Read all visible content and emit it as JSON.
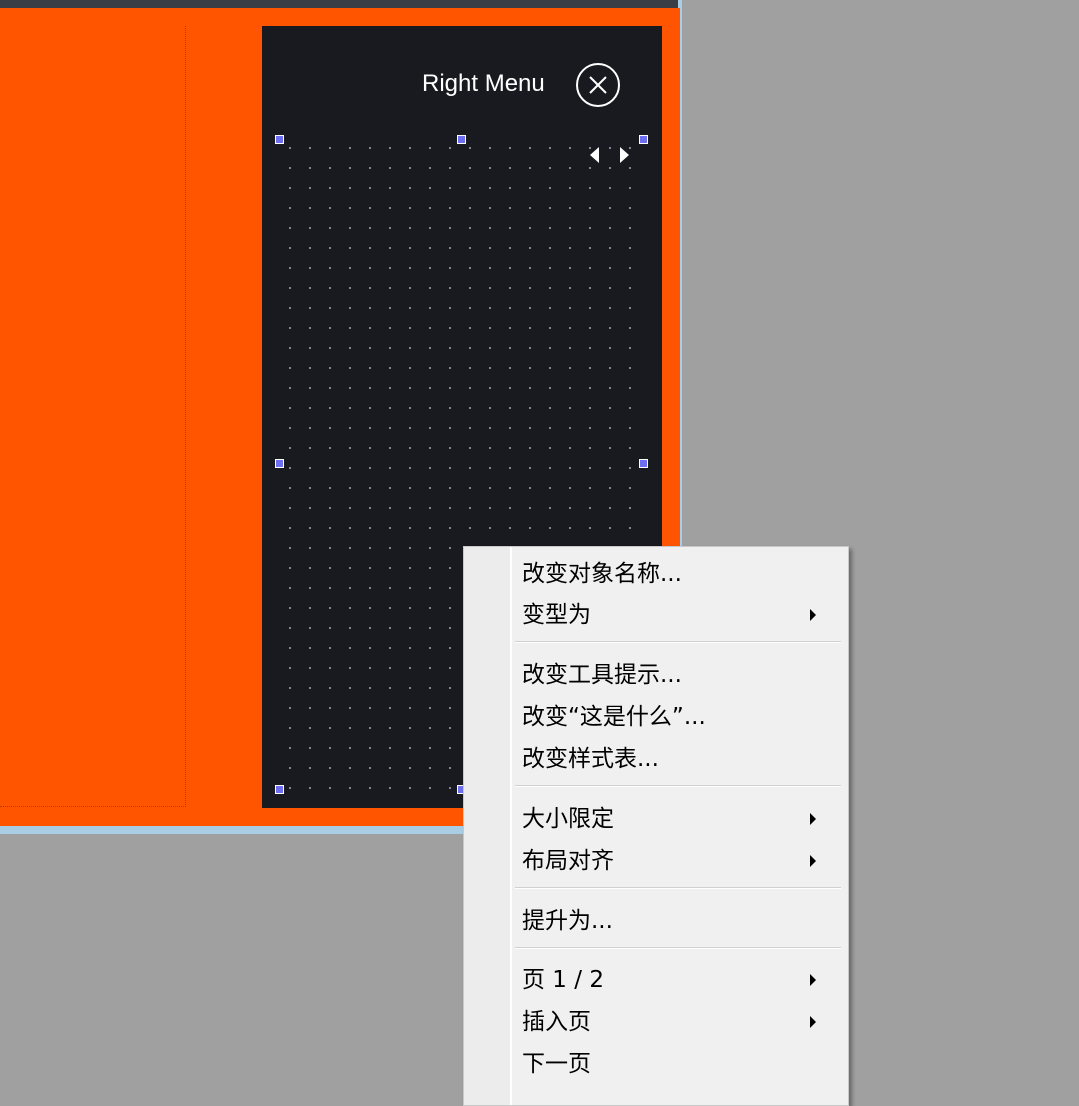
{
  "panel": {
    "title": "Right Menu",
    "close_icon": "close-circle-icon",
    "scroll_left_icon": "arrow-left-icon",
    "scroll_right_icon": "arrow-right-icon"
  },
  "context_menu": {
    "items": [
      {
        "label": "改变对象名称...",
        "submenu": false
      },
      {
        "label": "变型为",
        "submenu": true
      },
      {
        "label": "改变工具提示...",
        "submenu": false
      },
      {
        "label": "改变“这是什么”...",
        "submenu": false
      },
      {
        "label": "改变样式表...",
        "submenu": false
      },
      {
        "label": "大小限定",
        "submenu": true
      },
      {
        "label": "布局对齐",
        "submenu": true
      },
      {
        "label": "提升为...",
        "submenu": false
      },
      {
        "label": "页 1 / 2",
        "submenu": true
      },
      {
        "label": "插入页",
        "submenu": true
      },
      {
        "label": "下一页",
        "submenu": false
      }
    ]
  },
  "colors": {
    "form_background": "#ff5500",
    "panel_background": "#181a20",
    "desktop_background": "#a0a0a0",
    "menu_background": "#f0f0f0",
    "selection_handle": "#6e6ef0"
  }
}
